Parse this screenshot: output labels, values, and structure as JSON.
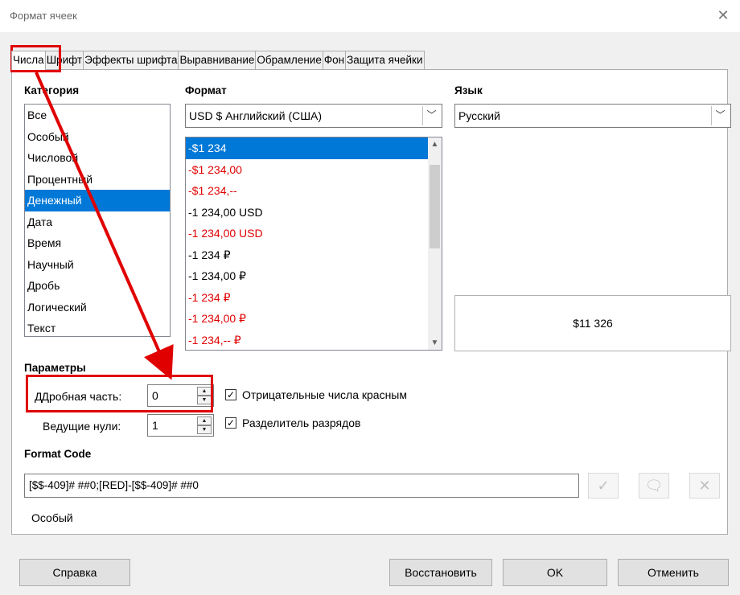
{
  "dialog": {
    "title": "Формат ячеек",
    "close_icon": "close-icon"
  },
  "tabs": [
    {
      "label": "Числа",
      "active": true
    },
    {
      "label": "Шрифт"
    },
    {
      "label": "Эффекты шрифта"
    },
    {
      "label": "Выравнивание"
    },
    {
      "label": "Обрамление"
    },
    {
      "label": "Фон"
    },
    {
      "label": "Защита ячейки"
    }
  ],
  "category": {
    "header": "Категория",
    "items": [
      "Все",
      "Особый",
      "Числовой",
      "Процентный",
      "Денежный",
      "Дата",
      "Время",
      "Научный",
      "Дробь",
      "Логический",
      "Текст"
    ],
    "selected": "Денежный"
  },
  "format": {
    "header": "Формат",
    "combo_value": "USD $ Английский (США)",
    "items": [
      {
        "text": "-$1 234",
        "red": false,
        "selected": true
      },
      {
        "text": "-$1 234,00",
        "red": true
      },
      {
        "text": "-$1 234,--",
        "red": true
      },
      {
        "text": "-1 234,00 USD",
        "red": false
      },
      {
        "text": "-1 234,00 USD",
        "red": true
      },
      {
        "text": "-1 234 ₽",
        "red": false
      },
      {
        "text": "-1 234,00 ₽",
        "red": false
      },
      {
        "text": "-1 234 ₽",
        "red": true
      },
      {
        "text": "-1 234,00 ₽",
        "red": true
      },
      {
        "text": "-1 234,-- ₽",
        "red": true
      }
    ]
  },
  "language": {
    "header": "Язык",
    "combo_value": "Русский"
  },
  "preview": {
    "value": "$11 326"
  },
  "params": {
    "header": "Параметры",
    "decimal_label": "Дробная часть:",
    "decimal_value": "0",
    "leading_label": "Ведущие нули:",
    "leading_value": "1",
    "negative_red_label": "Отрицательные числа красным",
    "negative_red_checked": true,
    "thousands_label": "Разделитель разрядов",
    "thousands_checked": true
  },
  "format_code": {
    "header": "Format Code",
    "value": "[$$-409]# ##0;[RED]-[$$-409]# ##0",
    "description": "Особый"
  },
  "buttons": {
    "help": "Справка",
    "reset": "Восстановить",
    "ok": "OK",
    "cancel": "Отменить"
  },
  "colors": {
    "highlight": "#e00000",
    "selection": "#0078d7",
    "red_text": "#e00000"
  }
}
